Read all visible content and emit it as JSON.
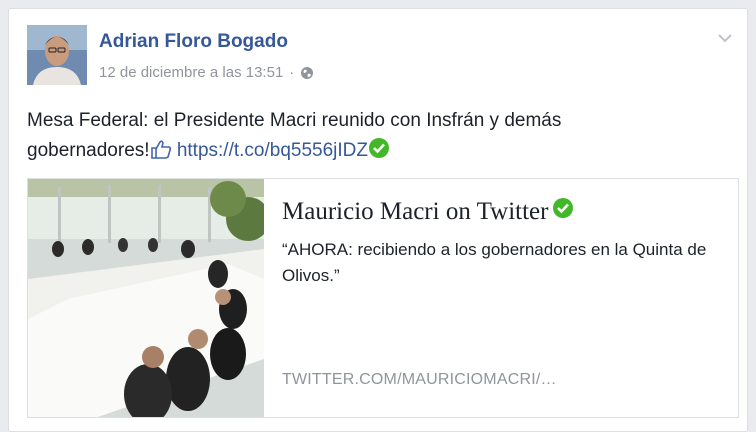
{
  "post": {
    "author_name": "Adrian Floro Bogado",
    "timestamp": "12 de diciembre a las 13:51",
    "meta_separator": "·",
    "privacy_icon": "globe-icon",
    "menu_icon": "chevron-down-icon",
    "text_part1": "Mesa Federal: el Presidente Macri reunido con Insfrán y demás gobernadores!",
    "inline_icon": "like-icon",
    "link_text": "https://t.co/bq5556jIDZ",
    "verified_icon": "check-icon"
  },
  "preview": {
    "title": "Mauricio Macri on Twitter",
    "description": "“AHORA: recibiendo a los gobernadores en la Quinta de Olivos.”",
    "domain": "TWITTER.COM/MAURICIOMACRI/…"
  },
  "colors": {
    "link_blue": "#365899",
    "meta_gray": "#90949c",
    "verified_green": "#42b72a",
    "text_dark": "#1d2129"
  }
}
